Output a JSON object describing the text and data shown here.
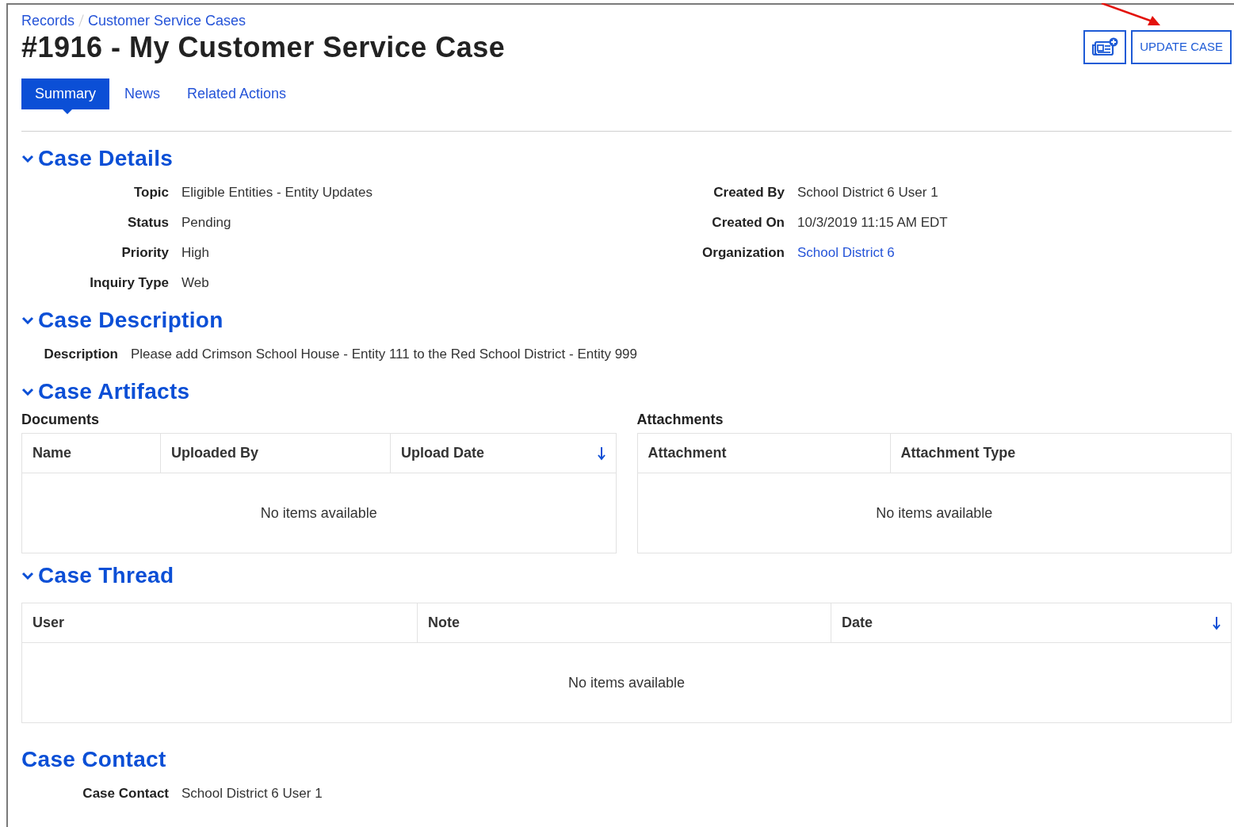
{
  "breadcrumbs": [
    "Records",
    "Customer Service Cases"
  ],
  "title": "#1916 - My Customer Service Case",
  "header_buttons": [
    {
      "kind": "icon"
    },
    {
      "kind": "text",
      "label": "UPDATE CASE"
    }
  ],
  "tabs": [
    {
      "label": "Summary",
      "selected": true
    },
    {
      "label": "News",
      "selected": false
    },
    {
      "label": "Related Actions",
      "selected": false
    }
  ],
  "sections": [
    {
      "kind": "collapsible",
      "expanded": true,
      "title": "Case Details",
      "field_columns": [
        [
          {
            "label": "Topic",
            "value": "Eligible Entities - Entity Updates",
            "link": false
          },
          {
            "label": "Status",
            "value": "Pending",
            "link": false
          },
          {
            "label": "Priority",
            "value": "High",
            "link": false
          },
          {
            "label": "Inquiry Type",
            "value": "Web",
            "link": false
          }
        ],
        [
          {
            "label": "Created By",
            "value": "School District 6 User 1",
            "link": false
          },
          {
            "label": "Created On",
            "value": "10/3/2019 11:15 AM EDT",
            "link": false
          },
          {
            "label": "Organization",
            "value": "School District 6",
            "link": true
          }
        ]
      ]
    },
    {
      "kind": "collapsible",
      "expanded": true,
      "title": "Case Description",
      "field_columns": [
        [
          {
            "label": "Description",
            "value": "Please add Crimson School House - Entity 111 to the Red School District - Entity 999",
            "link": false
          }
        ]
      ]
    },
    {
      "kind": "collapsible",
      "expanded": true,
      "title": "Case Artifacts",
      "tables": [
        {
          "title": "Documents",
          "columns": [
            {
              "label": "Name",
              "sorted": false
            },
            {
              "label": "Uploaded By",
              "sorted": false
            },
            {
              "label": "Upload Date",
              "sorted": true
            }
          ],
          "empty_text": "No items available"
        },
        {
          "title": "Attachments",
          "columns": [
            {
              "label": "Attachment",
              "sorted": false
            },
            {
              "label": "Attachment Type",
              "sorted": false
            }
          ],
          "empty_text": "No items available"
        }
      ]
    },
    {
      "kind": "collapsible",
      "expanded": true,
      "title": "Case Thread",
      "tables": [
        {
          "columns": [
            {
              "label": "User",
              "sorted": false
            },
            {
              "label": "Note",
              "sorted": false
            },
            {
              "label": "Date",
              "sorted": true
            }
          ],
          "empty_text": "No items available"
        }
      ]
    },
    {
      "kind": "plain",
      "title": "Case Contact",
      "field_columns": [
        [
          {
            "label": "Case Contact",
            "value": "School District 6 User 1",
            "link": false
          }
        ]
      ]
    }
  ]
}
